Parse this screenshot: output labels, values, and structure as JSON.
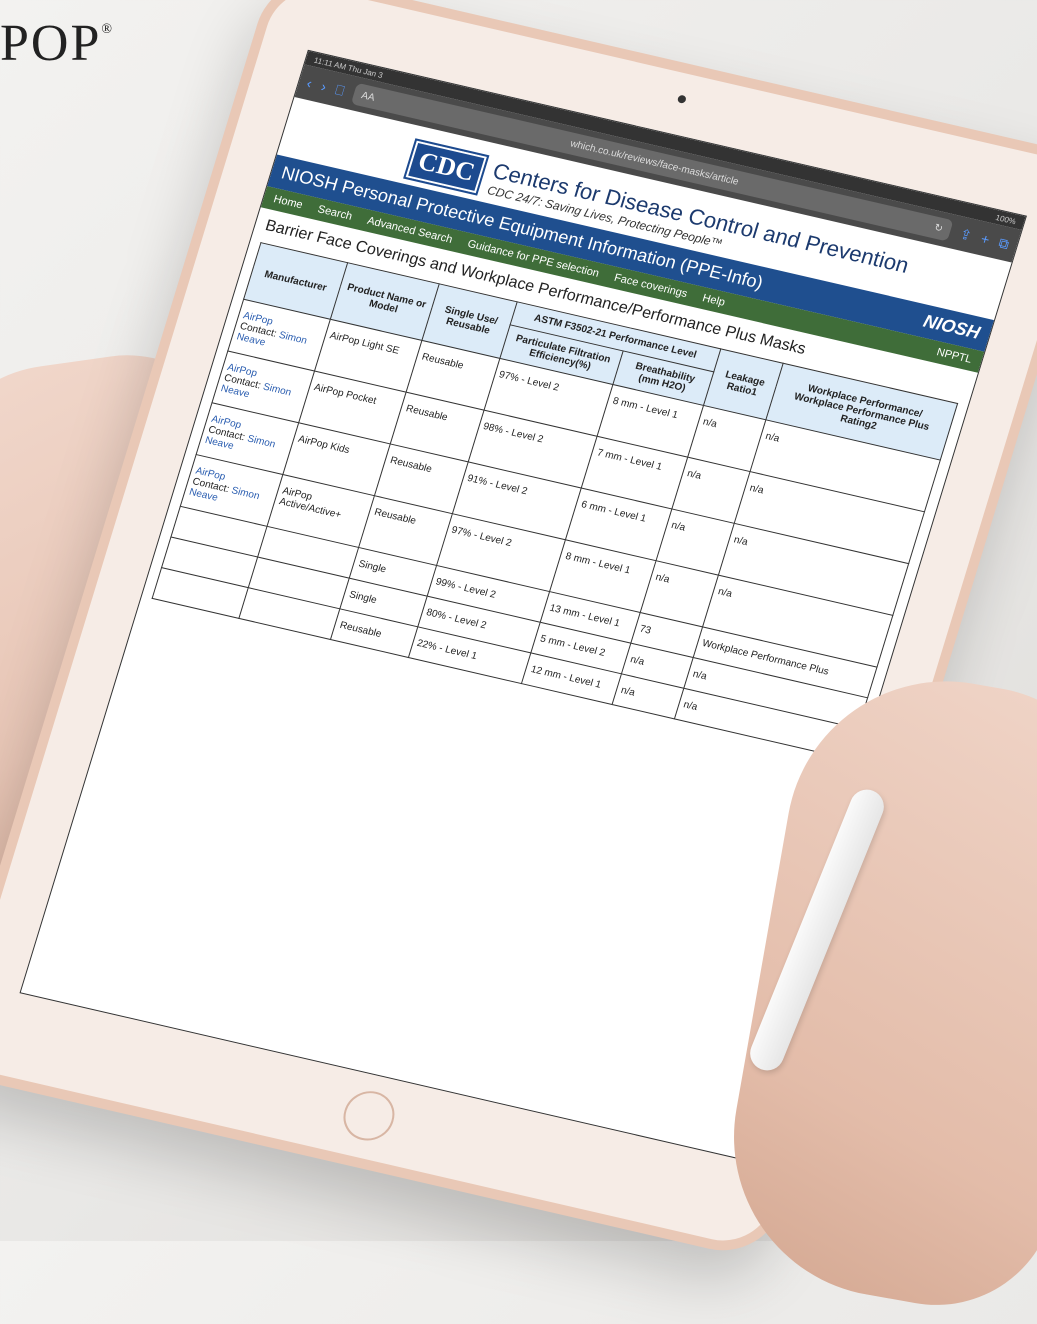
{
  "brand": {
    "name": "POP",
    "mark": "®"
  },
  "browser": {
    "status_time": "11:11 AM  Thu Jan 3",
    "status_right": "100%",
    "address_left": "AA",
    "url": "which.co.uk/reviews/face-masks/article",
    "reload_icon": "reload-icon"
  },
  "header": {
    "logo": "CDC",
    "title": "Centers for Disease Control and Prevention",
    "subtitle": "CDC 24/7: Saving Lives, Protecting People™"
  },
  "niosh": {
    "title": "NIOSH Personal Protective Equipment Information (PPE-Info)",
    "logo": "NIOSH"
  },
  "menu": {
    "items": [
      "Home",
      "Search",
      "Advanced Search",
      "Guidance for PPE selection",
      "Face coverings",
      "Help"
    ],
    "right": "NPPTL"
  },
  "page_title": "Barrier Face Coverings and Workplace Performance/Performance Plus Masks",
  "table": {
    "group_header": "ASTM F3502-21 Performance Level",
    "headers": [
      "Manufacturer",
      "Product Name or Model",
      "Single Use/ Reusable",
      "Particulate Filtration Efficiency(%)",
      "Breathability (mm H2O)",
      "Leakage Ratio1",
      "Workplace Performance/ Workplace Performance Plus Rating2"
    ],
    "rows": [
      {
        "mfr": "AirPop",
        "contact_label": "Contact:",
        "contact": "Simon Neave",
        "model": "AirPop Light SE",
        "use": "Reusable",
        "pfe": "97% - Level 2",
        "breath": "8 mm - Level 1",
        "leak": "n/a",
        "rating": "n/a"
      },
      {
        "mfr": "AirPop",
        "contact_label": "Contact:",
        "contact": "Simon Neave",
        "model": "AirPop Pocket",
        "use": "Reusable",
        "pfe": "98% - Level 2",
        "breath": "7 mm - Level 1",
        "leak": "n/a",
        "rating": "n/a"
      },
      {
        "mfr": "AirPop",
        "contact_label": "Contact:",
        "contact": "Simon Neave",
        "model": "AirPop Kids",
        "use": "Reusable",
        "pfe": "91% - Level 2",
        "breath": "6 mm - Level 1",
        "leak": "n/a",
        "rating": "n/a"
      },
      {
        "mfr": "AirPop",
        "contact_label": "Contact:",
        "contact": "Simon Neave",
        "model": "AirPop Active/Active+",
        "use": "Reusable",
        "pfe": "97% - Level 2",
        "breath": "8 mm - Level 1",
        "leak": "n/a",
        "rating": "n/a"
      },
      {
        "mfr": "",
        "contact_label": "",
        "contact": "",
        "model": "",
        "use": "Single",
        "pfe": "99% - Level 2",
        "breath": "13 mm - Level 1",
        "leak": "73",
        "rating": "Workplace Performance Plus"
      },
      {
        "mfr": "",
        "contact_label": "",
        "contact": "",
        "model": "",
        "use": "Single",
        "pfe": "80% - Level 2",
        "breath": "5 mm - Level 2",
        "leak": "n/a",
        "rating": "n/a"
      },
      {
        "mfr": "",
        "contact_label": "",
        "contact": "",
        "model": "",
        "use": "Reusable",
        "pfe": "22% - Level 1",
        "breath": "12 mm - Level 1",
        "leak": "n/a",
        "rating": "n/a"
      }
    ]
  }
}
